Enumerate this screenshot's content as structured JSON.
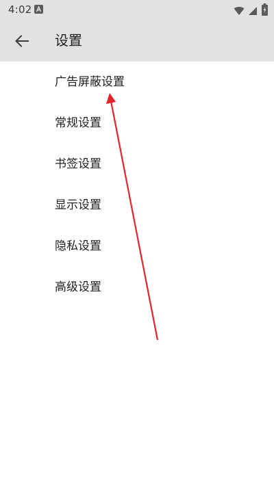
{
  "status_bar": {
    "time": "4:02",
    "notification_icon": "a-letter-icon",
    "icons": [
      "wifi-icon",
      "cellular-signal-icon",
      "battery-charging-icon"
    ]
  },
  "app_bar": {
    "back_icon": "arrow-back-icon",
    "title": "设置"
  },
  "settings": {
    "items": [
      {
        "label": "广告屏蔽设置"
      },
      {
        "label": "常规设置"
      },
      {
        "label": "书签设置"
      },
      {
        "label": "显示设置"
      },
      {
        "label": "隐私设置"
      },
      {
        "label": "高级设置"
      }
    ]
  },
  "annotation": {
    "color": "#e8222b"
  }
}
